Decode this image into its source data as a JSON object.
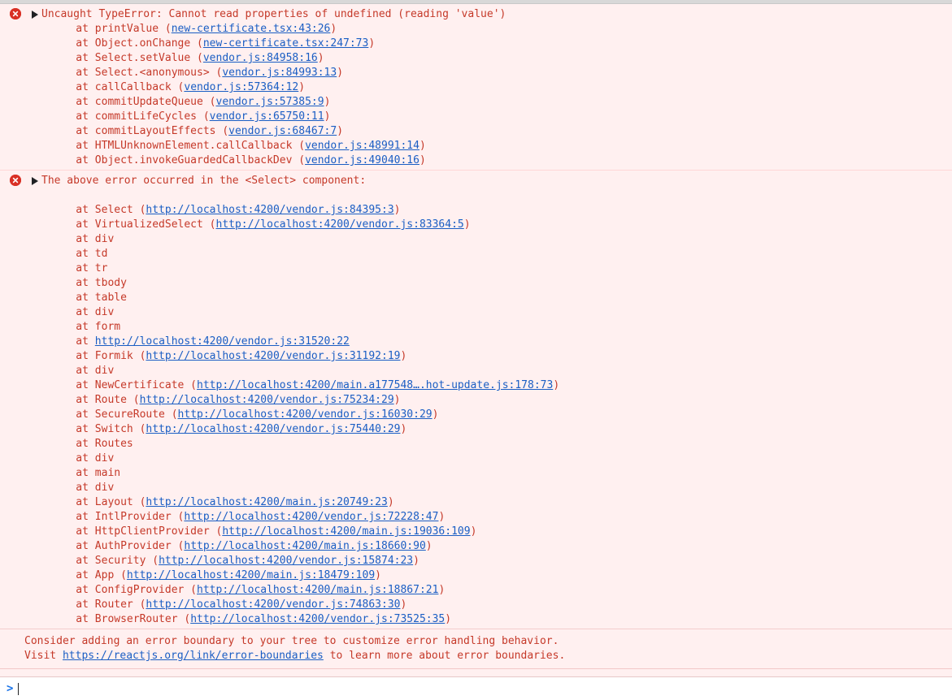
{
  "console": {
    "prompt_symbol": ">",
    "prompt_value": "",
    "prompt_placeholder": "",
    "colors": {
      "error_text": "#c53929",
      "error_background": "#fff0f0",
      "link": "#1a5ec4",
      "badge": "#d93025",
      "prompt_chevron": "#1a73e8"
    }
  },
  "errors": [
    {
      "icon": "error-circle-icon",
      "expander": "disclosure-triangle-collapsed-icon",
      "title": "Uncaught TypeError: Cannot read properties of undefined (reading 'value')",
      "frames": [
        {
          "text": "    at printValue (",
          "link": "new-certificate.tsx:43:26",
          "suffix": ")"
        },
        {
          "text": "    at Object.onChange (",
          "link": "new-certificate.tsx:247:73",
          "suffix": ")"
        },
        {
          "text": "    at Select.setValue (",
          "link": "vendor.js:84958:16",
          "suffix": ")"
        },
        {
          "text": "    at Select.<anonymous> (",
          "link": "vendor.js:84993:13",
          "suffix": ")"
        },
        {
          "text": "    at callCallback (",
          "link": "vendor.js:57364:12",
          "suffix": ")"
        },
        {
          "text": "    at commitUpdateQueue (",
          "link": "vendor.js:57385:9",
          "suffix": ")"
        },
        {
          "text": "    at commitLifeCycles (",
          "link": "vendor.js:65750:11",
          "suffix": ")"
        },
        {
          "text": "    at commitLayoutEffects (",
          "link": "vendor.js:68467:7",
          "suffix": ")"
        },
        {
          "text": "    at HTMLUnknownElement.callCallback (",
          "link": "vendor.js:48991:14",
          "suffix": ")"
        },
        {
          "text": "    at Object.invokeGuardedCallbackDev (",
          "link": "vendor.js:49040:16",
          "suffix": ")"
        }
      ]
    },
    {
      "icon": "error-circle-icon",
      "expander": "disclosure-triangle-collapsed-icon",
      "title": "The above error occurred in the <Select> component:",
      "frames": [
        {
          "text": "",
          "link": "",
          "suffix": ""
        },
        {
          "text": "    at Select (",
          "link": "http://localhost:4200/vendor.js:84395:3",
          "suffix": ")"
        },
        {
          "text": "    at VirtualizedSelect (",
          "link": "http://localhost:4200/vendor.js:83364:5",
          "suffix": ")"
        },
        {
          "text": "    at div",
          "link": "",
          "suffix": ""
        },
        {
          "text": "    at td",
          "link": "",
          "suffix": ""
        },
        {
          "text": "    at tr",
          "link": "",
          "suffix": ""
        },
        {
          "text": "    at tbody",
          "link": "",
          "suffix": ""
        },
        {
          "text": "    at table",
          "link": "",
          "suffix": ""
        },
        {
          "text": "    at div",
          "link": "",
          "suffix": ""
        },
        {
          "text": "    at form",
          "link": "",
          "suffix": ""
        },
        {
          "text": "    at ",
          "link": "http://localhost:4200/vendor.js:31520:22",
          "suffix": ""
        },
        {
          "text": "    at Formik (",
          "link": "http://localhost:4200/vendor.js:31192:19",
          "suffix": ")"
        },
        {
          "text": "    at div",
          "link": "",
          "suffix": ""
        },
        {
          "text": "    at NewCertificate (",
          "link": "http://localhost:4200/main.a177548….hot-update.js:178:73",
          "suffix": ")"
        },
        {
          "text": "    at Route (",
          "link": "http://localhost:4200/vendor.js:75234:29",
          "suffix": ")"
        },
        {
          "text": "    at SecureRoute (",
          "link": "http://localhost:4200/vendor.js:16030:29",
          "suffix": ")"
        },
        {
          "text": "    at Switch (",
          "link": "http://localhost:4200/vendor.js:75440:29",
          "suffix": ")"
        },
        {
          "text": "    at Routes",
          "link": "",
          "suffix": ""
        },
        {
          "text": "    at div",
          "link": "",
          "suffix": ""
        },
        {
          "text": "    at main",
          "link": "",
          "suffix": ""
        },
        {
          "text": "    at div",
          "link": "",
          "suffix": ""
        },
        {
          "text": "    at Layout (",
          "link": "http://localhost:4200/main.js:20749:23",
          "suffix": ")"
        },
        {
          "text": "    at IntlProvider (",
          "link": "http://localhost:4200/vendor.js:72228:47",
          "suffix": ")"
        },
        {
          "text": "    at HttpClientProvider (",
          "link": "http://localhost:4200/main.js:19036:109",
          "suffix": ")"
        },
        {
          "text": "    at AuthProvider (",
          "link": "http://localhost:4200/main.js:18660:90",
          "suffix": ")"
        },
        {
          "text": "    at Security (",
          "link": "http://localhost:4200/vendor.js:15874:23",
          "suffix": ")"
        },
        {
          "text": "    at App (",
          "link": "http://localhost:4200/main.js:18479:109",
          "suffix": ")"
        },
        {
          "text": "    at ConfigProvider (",
          "link": "http://localhost:4200/main.js:18867:21",
          "suffix": ")"
        },
        {
          "text": "    at Router (",
          "link": "http://localhost:4200/vendor.js:74863:30",
          "suffix": ")"
        },
        {
          "text": "    at BrowserRouter (",
          "link": "http://localhost:4200/vendor.js:73525:35",
          "suffix": ")"
        }
      ]
    }
  ],
  "footnote": {
    "line1": "Consider adding an error boundary to your tree to customize error handling behavior.",
    "line2_prefix": "Visit ",
    "line2_link": "https://reactjs.org/link/error-boundaries",
    "line2_suffix": " to learn more about error boundaries."
  }
}
